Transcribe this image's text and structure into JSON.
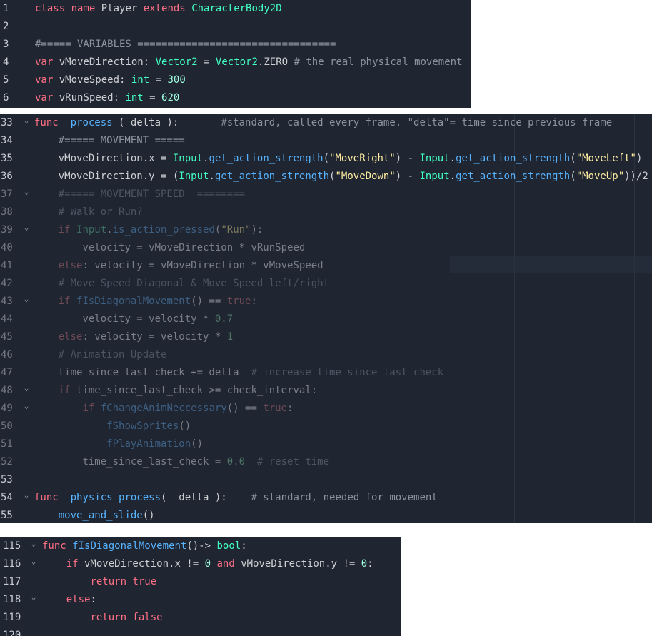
{
  "panels": [
    {
      "lines": [
        {
          "no": "1",
          "fold": false,
          "indent": 0,
          "tokens": [
            [
              "kw",
              "class_name"
            ],
            [
              "tx",
              " Player "
            ],
            [
              "kw",
              "extends"
            ],
            [
              "tx",
              " "
            ],
            [
              "ty",
              "CharacterBody2D"
            ]
          ]
        },
        {
          "no": "2",
          "fold": false,
          "indent": 0,
          "tokens": []
        },
        {
          "no": "3",
          "fold": false,
          "indent": 0,
          "tokens": [
            [
              "cm",
              "#===== VARIABLES ================================="
            ]
          ]
        },
        {
          "no": "4",
          "fold": false,
          "indent": 0,
          "tokens": [
            [
              "kw",
              "var"
            ],
            [
              "tx",
              " vMoveDirection: "
            ],
            [
              "ty",
              "Vector2"
            ],
            [
              "tx",
              " = "
            ],
            [
              "ty",
              "Vector2"
            ],
            [
              "tx",
              ".ZERO "
            ],
            [
              "cm",
              "# the real physical movement"
            ]
          ]
        },
        {
          "no": "5",
          "fold": false,
          "indent": 0,
          "tokens": [
            [
              "kw",
              "var"
            ],
            [
              "tx",
              " vMoveSpeed: "
            ],
            [
              "ty",
              "int"
            ],
            [
              "tx",
              " = "
            ],
            [
              "num",
              "300"
            ]
          ]
        },
        {
          "no": "6",
          "fold": false,
          "indent": 0,
          "tokens": [
            [
              "kw",
              "var"
            ],
            [
              "tx",
              " vRunSpeed: "
            ],
            [
              "ty",
              "int"
            ],
            [
              "tx",
              " = "
            ],
            [
              "num",
              "620"
            ]
          ]
        }
      ]
    },
    {
      "lines": [
        {
          "no": "33",
          "fold": true,
          "indent": 0,
          "dim": false,
          "tokens": [
            [
              "kw",
              "func"
            ],
            [
              "tx",
              " "
            ],
            [
              "fn",
              "_process"
            ],
            [
              "tx",
              " ( delta ):       "
            ],
            [
              "cm",
              "#standard, called every frame. \"delta\"= time since previous frame"
            ]
          ]
        },
        {
          "no": "34",
          "fold": false,
          "indent": 1,
          "dim": false,
          "tokens": [
            [
              "cm",
              "#===== MOVEMENT ====="
            ]
          ]
        },
        {
          "no": "35",
          "fold": false,
          "indent": 1,
          "dim": false,
          "tokens": [
            [
              "tx",
              "vMoveDirection.x = "
            ],
            [
              "ty",
              "Input"
            ],
            [
              "tx",
              "."
            ],
            [
              "fn",
              "get_action_strength"
            ],
            [
              "tx",
              "("
            ],
            [
              "str",
              "\"MoveRight\""
            ],
            [
              "tx",
              ") - "
            ],
            [
              "ty",
              "Input"
            ],
            [
              "tx",
              "."
            ],
            [
              "fn",
              "get_action_strength"
            ],
            [
              "tx",
              "("
            ],
            [
              "str",
              "\"MoveLeft\""
            ],
            [
              "tx",
              ")"
            ]
          ]
        },
        {
          "no": "36",
          "fold": false,
          "indent": 1,
          "dim": false,
          "tokens": [
            [
              "tx",
              "vMoveDirection.y = ("
            ],
            [
              "ty",
              "Input"
            ],
            [
              "tx",
              "."
            ],
            [
              "fn",
              "get_action_strength"
            ],
            [
              "tx",
              "("
            ],
            [
              "str",
              "\"MoveDown\""
            ],
            [
              "tx",
              ") - "
            ],
            [
              "ty",
              "Input"
            ],
            [
              "tx",
              "."
            ],
            [
              "fn",
              "get_action_strength"
            ],
            [
              "tx",
              "("
            ],
            [
              "str",
              "\"MoveUp\""
            ],
            [
              "tx",
              "))/2"
            ]
          ]
        },
        {
          "no": "37",
          "fold": true,
          "indent": 1,
          "dim": true,
          "tokens": [
            [
              "cm",
              "#===== MOVEMENT SPEED  ========"
            ]
          ]
        },
        {
          "no": "38",
          "fold": false,
          "indent": 1,
          "dim": true,
          "tokens": [
            [
              "cm",
              "# Walk or Run?"
            ]
          ]
        },
        {
          "no": "39",
          "fold": true,
          "indent": 1,
          "dim": true,
          "tokens": [
            [
              "kw",
              "if"
            ],
            [
              "tx",
              " "
            ],
            [
              "ty",
              "Input"
            ],
            [
              "tx",
              "."
            ],
            [
              "fn",
              "is_action_pressed"
            ],
            [
              "tx",
              "("
            ],
            [
              "str",
              "\"Run\""
            ],
            [
              "tx",
              "):"
            ]
          ]
        },
        {
          "no": "40",
          "fold": false,
          "indent": 2,
          "dim": true,
          "tokens": [
            [
              "tx",
              "velocity = vMoveDirection * vRunSpeed"
            ]
          ]
        },
        {
          "no": "41",
          "fold": false,
          "indent": 1,
          "dim": true,
          "tokens": [
            [
              "kw",
              "else"
            ],
            [
              "tx",
              ": velocity = vMoveDirection * vMoveSpeed"
            ]
          ]
        },
        {
          "no": "42",
          "fold": false,
          "indent": 1,
          "dim": true,
          "tokens": [
            [
              "cm",
              "# Move Speed Diagonal & Move Speed left/right"
            ]
          ]
        },
        {
          "no": "43",
          "fold": true,
          "indent": 1,
          "dim": true,
          "tokens": [
            [
              "kw",
              "if"
            ],
            [
              "tx",
              " "
            ],
            [
              "fn",
              "fIsDiagonalMovement"
            ],
            [
              "tx",
              "() == "
            ],
            [
              "kw",
              "true"
            ],
            [
              "tx",
              ":"
            ]
          ]
        },
        {
          "no": "44",
          "fold": false,
          "indent": 2,
          "dim": true,
          "tokens": [
            [
              "tx",
              "velocity = velocity * "
            ],
            [
              "num",
              "0.7"
            ]
          ]
        },
        {
          "no": "45",
          "fold": false,
          "indent": 1,
          "dim": true,
          "tokens": [
            [
              "kw",
              "else"
            ],
            [
              "tx",
              ": velocity = velocity * "
            ],
            [
              "num",
              "1"
            ]
          ]
        },
        {
          "no": "46",
          "fold": false,
          "indent": 1,
          "dim": true,
          "tokens": [
            [
              "cm",
              "# Animation Update"
            ]
          ]
        },
        {
          "no": "47",
          "fold": false,
          "indent": 1,
          "dim": true,
          "tokens": [
            [
              "tx",
              "time_since_last_check += delta  "
            ],
            [
              "cm",
              "# increase time since last check"
            ]
          ]
        },
        {
          "no": "48",
          "fold": true,
          "indent": 1,
          "dim": true,
          "tokens": [
            [
              "kw",
              "if"
            ],
            [
              "tx",
              " time_since_last_check >= check_interval:"
            ]
          ]
        },
        {
          "no": "49",
          "fold": true,
          "indent": 2,
          "dim": true,
          "tokens": [
            [
              "kw",
              "if"
            ],
            [
              "tx",
              " "
            ],
            [
              "fn",
              "fChangeAnimNeccessary"
            ],
            [
              "tx",
              "() == "
            ],
            [
              "kw",
              "true"
            ],
            [
              "tx",
              ":"
            ]
          ]
        },
        {
          "no": "50",
          "fold": false,
          "indent": 3,
          "dim": true,
          "tokens": [
            [
              "fn",
              "fShowSprites"
            ],
            [
              "tx",
              "()"
            ]
          ]
        },
        {
          "no": "51",
          "fold": false,
          "indent": 3,
          "dim": true,
          "tokens": [
            [
              "fn",
              "fPlayAnimation"
            ],
            [
              "tx",
              "()"
            ]
          ]
        },
        {
          "no": "52",
          "fold": false,
          "indent": 2,
          "dim": true,
          "tokens": [
            [
              "tx",
              "time_since_last_check = "
            ],
            [
              "num",
              "0.0"
            ],
            [
              "tx",
              "  "
            ],
            [
              "cm",
              "# reset time"
            ]
          ]
        },
        {
          "no": "53",
          "fold": false,
          "indent": 0,
          "dim": false,
          "tokens": []
        },
        {
          "no": "54",
          "fold": true,
          "indent": 0,
          "dim": false,
          "tokens": [
            [
              "kw",
              "func"
            ],
            [
              "tx",
              " "
            ],
            [
              "fn",
              "_physics_process"
            ],
            [
              "tx",
              "( _delta ):    "
            ],
            [
              "cm",
              "# standard, needed for movement"
            ]
          ]
        },
        {
          "no": "55",
          "fold": false,
          "indent": 1,
          "dim": false,
          "tokens": [
            [
              "fn",
              "move_and_slide"
            ],
            [
              "tx",
              "()"
            ]
          ]
        }
      ]
    },
    {
      "lines": [
        {
          "no": "115",
          "fold": true,
          "indent": 0,
          "tokens": [
            [
              "kw",
              "func"
            ],
            [
              "tx",
              " "
            ],
            [
              "fn",
              "fIsDiagonalMovement"
            ],
            [
              "tx",
              "()-> "
            ],
            [
              "ty",
              "bool"
            ],
            [
              "tx",
              ":"
            ]
          ]
        },
        {
          "no": "116",
          "fold": true,
          "indent": 1,
          "tokens": [
            [
              "kw",
              "if"
            ],
            [
              "tx",
              " vMoveDirection.x != "
            ],
            [
              "num",
              "0"
            ],
            [
              "tx",
              " "
            ],
            [
              "kw",
              "and"
            ],
            [
              "tx",
              " vMoveDirection.y != "
            ],
            [
              "num",
              "0"
            ],
            [
              "tx",
              ":"
            ]
          ]
        },
        {
          "no": "117",
          "fold": false,
          "indent": 2,
          "tokens": [
            [
              "kw",
              "return"
            ],
            [
              "tx",
              " "
            ],
            [
              "kw",
              "true"
            ]
          ]
        },
        {
          "no": "118",
          "fold": true,
          "indent": 1,
          "tokens": [
            [
              "kw",
              "else"
            ],
            [
              "tx",
              ":"
            ]
          ]
        },
        {
          "no": "119",
          "fold": false,
          "indent": 2,
          "tokens": [
            [
              "kw",
              "return"
            ],
            [
              "tx",
              " "
            ],
            [
              "kw",
              "false"
            ]
          ]
        },
        {
          "no": "120",
          "fold": false,
          "indent": 0,
          "tokens": []
        }
      ]
    }
  ]
}
